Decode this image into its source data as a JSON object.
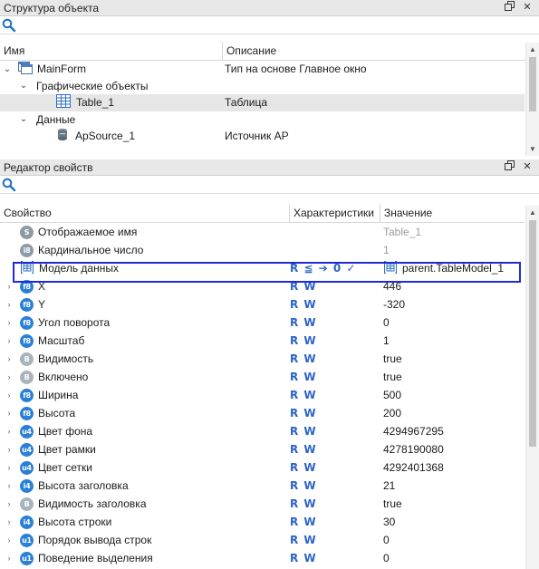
{
  "structure_panel": {
    "title": "Структура объекта",
    "search_placeholder": "",
    "columns": {
      "name": "Имя",
      "description": "Описание"
    },
    "rows": [
      {
        "name": "MainForm",
        "description": "Тип на основе Главное окно"
      },
      {
        "name": "Графические объекты",
        "description": ""
      },
      {
        "name": "Table_1",
        "description": "Таблица"
      },
      {
        "name": "Данные",
        "description": ""
      },
      {
        "name": "ApSource_1",
        "description": "Источник АР"
      }
    ]
  },
  "properties_panel": {
    "title": "Редактор свойств",
    "columns": {
      "property": "Свойство",
      "characteristics": "Характеристики",
      "value": "Значение"
    },
    "rows": [
      {
        "badge": "S",
        "name": "Отображаемое имя",
        "chars": "",
        "value": "Table_1"
      },
      {
        "badge": "i8",
        "name": "Кардинальное число",
        "chars": "",
        "value": "1"
      },
      {
        "badge": "",
        "name": "Модель данных",
        "chars": "R ≦ ➔ 0 ✓",
        "value": "parent.TableModel_1"
      },
      {
        "badge": "f8",
        "name": "X",
        "chars": "R W",
        "value": "446"
      },
      {
        "badge": "f8",
        "name": "Y",
        "chars": "R W",
        "value": "-320"
      },
      {
        "badge": "f8",
        "name": "Угол поворота",
        "chars": "R W",
        "value": "0"
      },
      {
        "badge": "f8",
        "name": "Масштаб",
        "chars": "R W",
        "value": "1"
      },
      {
        "badge": "B",
        "name": "Видимость",
        "chars": "R W",
        "value": "true"
      },
      {
        "badge": "B",
        "name": "Включено",
        "chars": "R W",
        "value": "true"
      },
      {
        "badge": "f8",
        "name": "Ширина",
        "chars": "R W",
        "value": "500"
      },
      {
        "badge": "f8",
        "name": "Высота",
        "chars": "R W",
        "value": "200"
      },
      {
        "badge": "u4",
        "name": "Цвет фона",
        "chars": "R W",
        "value": "4294967295"
      },
      {
        "badge": "u4",
        "name": "Цвет рамки",
        "chars": "R W",
        "value": "4278190080"
      },
      {
        "badge": "u4",
        "name": "Цвет сетки",
        "chars": "R W",
        "value": "4292401368"
      },
      {
        "badge": "i4",
        "name": "Высота заголовка",
        "chars": "R W",
        "value": "21"
      },
      {
        "badge": "B",
        "name": "Видимость заголовка",
        "chars": "R W",
        "value": "true"
      },
      {
        "badge": "i4",
        "name": "Высота строки",
        "chars": "R W",
        "value": "30"
      },
      {
        "badge": "u1",
        "name": "Порядок вывода строк",
        "chars": "R W",
        "value": "0"
      },
      {
        "badge": "u1",
        "name": "Поведение выделения",
        "chars": "R W",
        "value": "0"
      }
    ]
  },
  "icons": {
    "float_button": "float-icon",
    "close_button": "close-icon",
    "search": "search-icon",
    "window": "window-icon",
    "table": "table-icon",
    "database": "database-icon",
    "model": "model-icon"
  },
  "colors": {
    "badge_blue": "#2a7fd6",
    "badge_gray": "#8e9aa6",
    "rw_blue": "#2b63c6",
    "highlight": "#1f2bd8",
    "title_bar": "#e8e8e8"
  }
}
